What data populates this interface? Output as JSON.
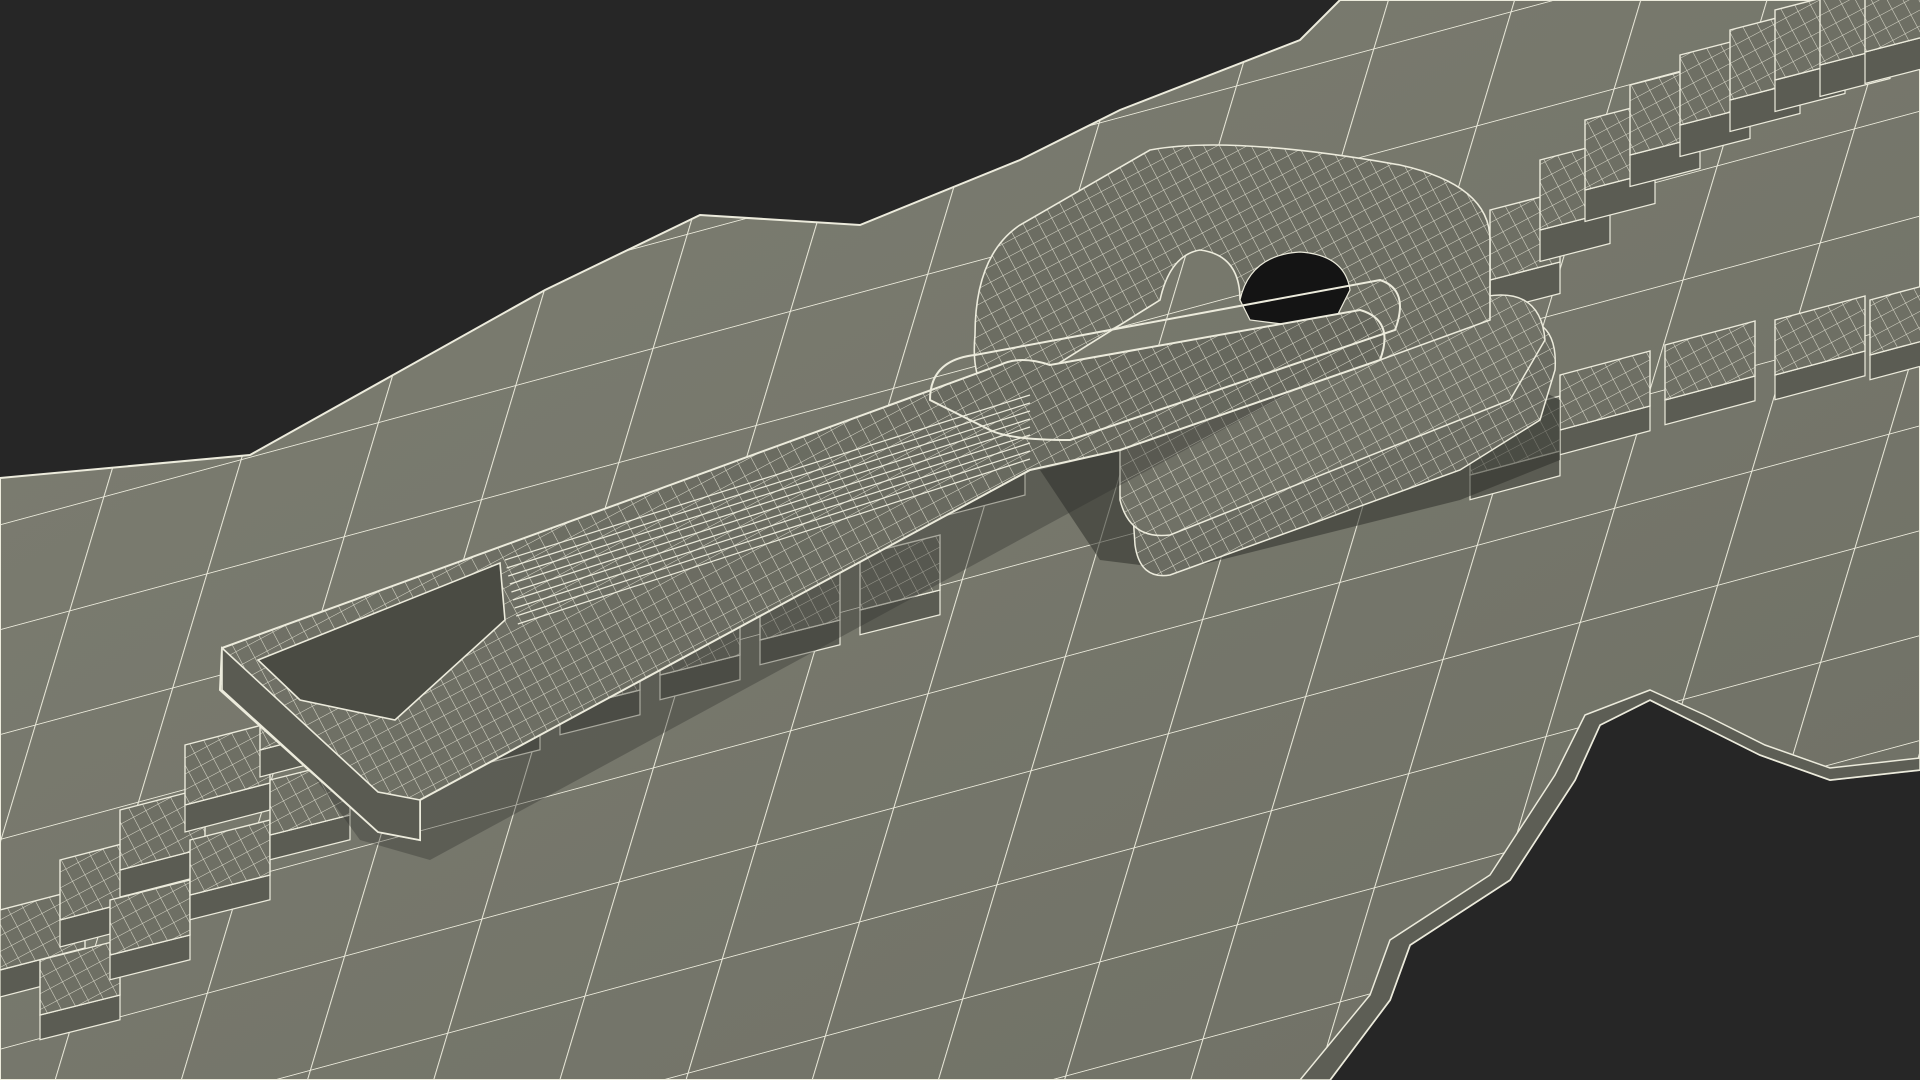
{
  "scene": {
    "subject": "zipper-wireframe-render",
    "colors": {
      "background": "#262626",
      "tape_fill": "#75766b",
      "tape_fill_light": "#7f8075",
      "part_fill": "#6e6f64",
      "part_fill_dark": "#5b5c53",
      "shadow": "#2e2f2a",
      "wire": "#ecebdc"
    }
  }
}
